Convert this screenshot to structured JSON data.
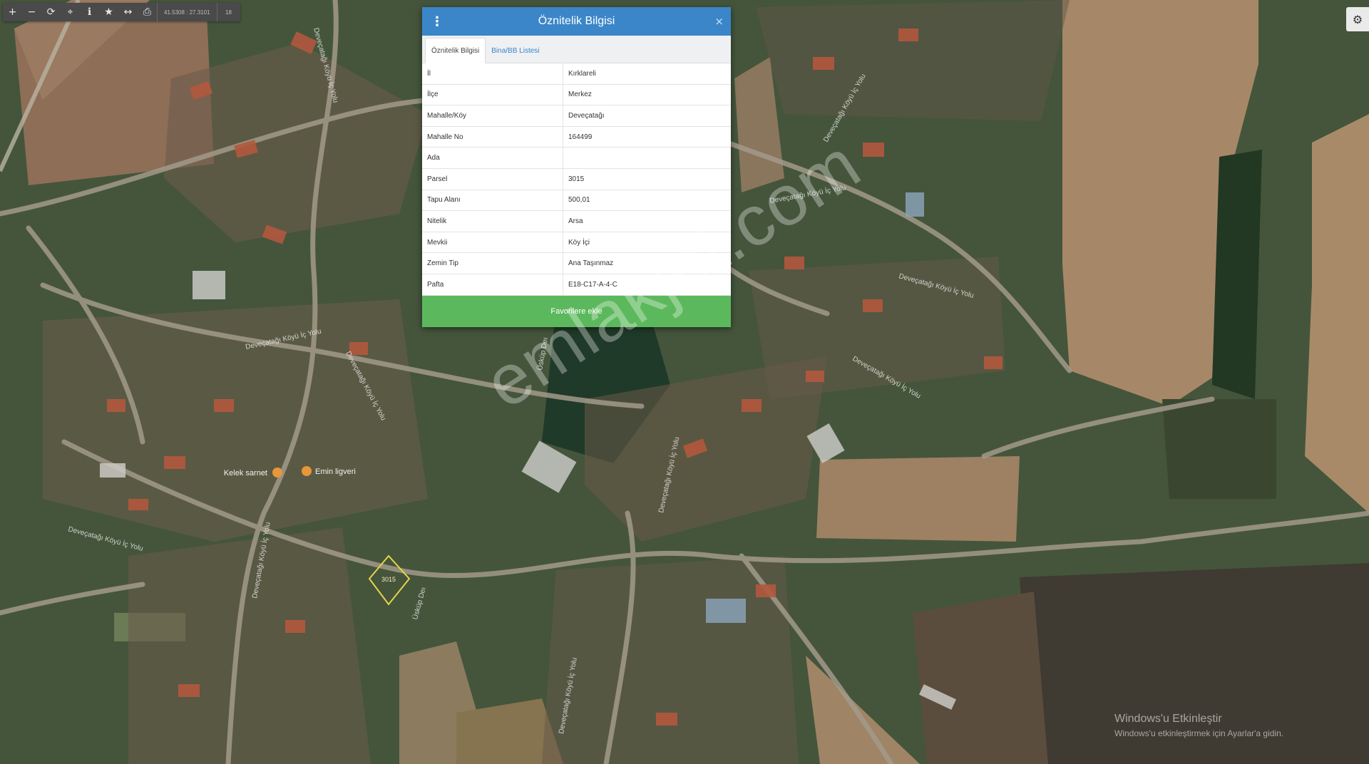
{
  "toolbar": {
    "buttons": [
      {
        "name": "zoom-in",
        "glyph": "+"
      },
      {
        "name": "zoom-out",
        "glyph": "−"
      },
      {
        "name": "refresh",
        "glyph": "⟳"
      },
      {
        "name": "locate",
        "glyph": "⌖"
      },
      {
        "name": "info",
        "glyph": "ℹ"
      },
      {
        "name": "favorites",
        "glyph": "★"
      },
      {
        "name": "measure",
        "glyph": "↔"
      },
      {
        "name": "print",
        "glyph": "⎙"
      }
    ],
    "coordinates": "41.5308 : 27.3101",
    "zoom": "18"
  },
  "settings_icon": "⚙",
  "panel": {
    "title": "Öznitelik Bilgisi",
    "menu_glyph": "⋮",
    "close_glyph": "×",
    "tabs": [
      {
        "label": "Öznitelik Bilgisi",
        "active": true
      },
      {
        "label": "Bina/BB Listesi",
        "active": false
      }
    ],
    "rows": [
      {
        "key": "İl",
        "value": "Kırklareli"
      },
      {
        "key": "İlçe",
        "value": "Merkez"
      },
      {
        "key": "Mahalle/Köy",
        "value": "Deveçatağı"
      },
      {
        "key": "Mahalle No",
        "value": "164499"
      },
      {
        "key": "Ada",
        "value": ""
      },
      {
        "key": "Parsel",
        "value": "3015"
      },
      {
        "key": "Tapu Alanı",
        "value": "500,01"
      },
      {
        "key": "Nitelik",
        "value": "Arsa"
      },
      {
        "key": "Mevkii",
        "value": "Köy İçi"
      },
      {
        "key": "Zemin Tip",
        "value": "Ana Taşınmaz"
      },
      {
        "key": "Pafta",
        "value": "E18-C17-A-4-C"
      }
    ],
    "favorite_button": "Favorilere ekle"
  },
  "map": {
    "parcel_label": "3015",
    "poi": [
      {
        "label": "Kelek sarnet"
      },
      {
        "label": "Emin ligveri"
      }
    ],
    "road_labels": [
      {
        "text": "Deveçatağı Köyü İç Yolu"
      },
      {
        "text": "Deveçatağı Köyü İç Yolu"
      },
      {
        "text": "Deveçatağı Köyü İç Yolu"
      },
      {
        "text": "Deveçatağı Köyü İç Yolu"
      },
      {
        "text": "Deveçatağı Köyü İç Yolu"
      },
      {
        "text": "Deveçatağı Köyü İç Yolu"
      },
      {
        "text": "Deveçatağı Köyü İç Yolu"
      },
      {
        "text": "Deveçatağı Köyü İç Yolu"
      },
      {
        "text": "Deveçatağı Köyü İç Yolu"
      },
      {
        "text": "Deveçatağı Köyü İç Yolu"
      },
      {
        "text": "Deveçatağı Köyü İç Yolu"
      },
      {
        "text": "Üsküp Deı"
      },
      {
        "text": "Üsküp Deı"
      }
    ]
  },
  "watermark": "emlakjet.com",
  "windows_activation": {
    "title": "Windows'u Etkinleştir",
    "subtitle": "Windows'u etkinleştirmek için Ayarlar'a gidin."
  },
  "colors": {
    "panel_header": "#3a86c8",
    "favorite_button": "#5cb85c",
    "parcel_outline": "#e8d24a"
  }
}
